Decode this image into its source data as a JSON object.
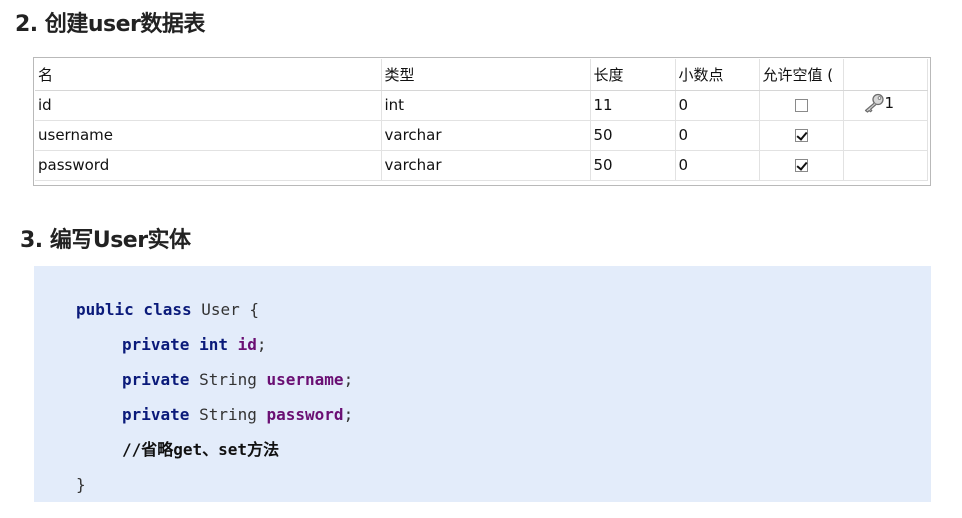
{
  "section2": {
    "title": "2. 创建user数据表"
  },
  "table": {
    "columns": [
      "名",
      "类型",
      "长度",
      "小数点",
      "允许空值 ("
    ],
    "rows": [
      {
        "name": "id",
        "type": "int",
        "length": "11",
        "decimal": "0",
        "nullable": false,
        "key": "1"
      },
      {
        "name": "username",
        "type": "varchar",
        "length": "50",
        "decimal": "0",
        "nullable": true,
        "key": ""
      },
      {
        "name": "password",
        "type": "varchar",
        "length": "50",
        "decimal": "0",
        "nullable": true,
        "key": ""
      }
    ],
    "key_icon": "key-icon"
  },
  "section3": {
    "title": "3. 编写User实体"
  },
  "code": {
    "line1_kw": "public class",
    "line1_rest": " User {",
    "line2_kw": "private int",
    "line2_field": "id",
    "line3_kw": "private",
    "line3_type": " String ",
    "line3_field": "username",
    "line4_kw": "private",
    "line4_type": " String ",
    "line4_field": "password",
    "line5_comment": "//省略get、set方法",
    "line6": "}",
    "semicolon": ";"
  },
  "colors": {
    "code_bg": "#e3ecfa",
    "keyword": "#0a1a7a",
    "field": "#6a0f73"
  }
}
